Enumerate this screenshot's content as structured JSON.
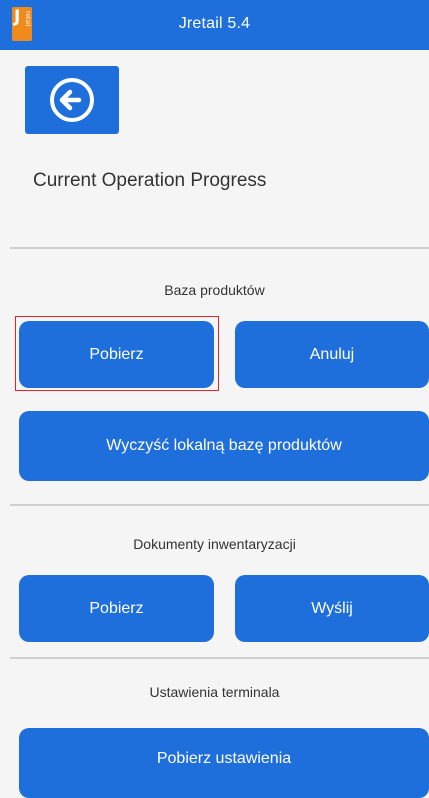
{
  "app": {
    "title": "Jretail 5.4",
    "logo_letter": "J",
    "logo_small": "retail"
  },
  "page": {
    "operation_title": "Current Operation Progress"
  },
  "sections": [
    {
      "label": "Baza produktów",
      "buttons": [
        "Pobierz",
        "Anuluj",
        "Wyczyść lokalną bazę produktów"
      ]
    },
    {
      "label": "Dokumenty inwentaryzacji",
      "buttons": [
        "Pobierz",
        "Wyślij"
      ]
    },
    {
      "label": "Ustawienia terminala",
      "buttons": [
        "Pobierz ustawienia"
      ]
    }
  ],
  "colors": {
    "accent": "#1e6fdc",
    "logo": "#f08a1c",
    "background": "#f5f5f5",
    "highlight": "#e8242a"
  },
  "icons": {
    "back": "arrow-left-circle-icon"
  }
}
